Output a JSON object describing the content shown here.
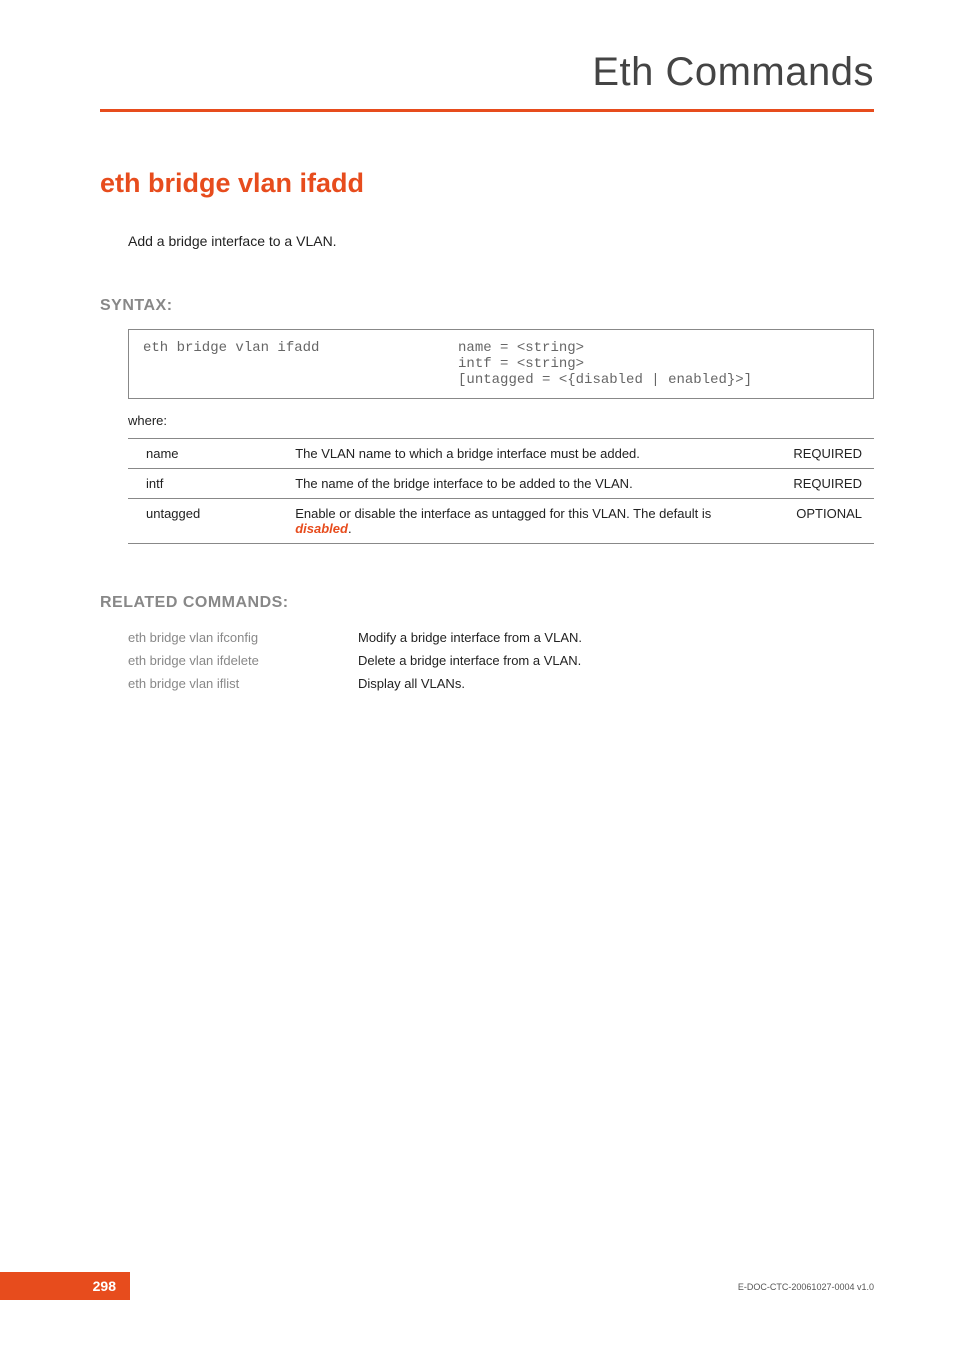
{
  "header": {
    "title": "Eth Commands"
  },
  "command": {
    "title": "eth bridge vlan ifadd",
    "description": "Add a bridge interface to a VLAN."
  },
  "syntax": {
    "label": "SYNTAX:",
    "left": "eth bridge vlan ifadd",
    "right": "name = <string>\nintf = <string>\n[untagged = <{disabled | enabled}>]",
    "where": "where:"
  },
  "params": [
    {
      "name": "name",
      "desc": "The VLAN name to which a bridge interface must be added.",
      "req": "REQUIRED"
    },
    {
      "name": "intf",
      "desc": "The name of the bridge interface to be added to the VLAN.",
      "req": "REQUIRED"
    },
    {
      "name": "untagged",
      "desc_pre": "Enable or disable the interface as untagged for this VLAN. The default is ",
      "desc_em": "disabled",
      "desc_post": ".",
      "req": "OPTIONAL"
    }
  ],
  "related": {
    "label": "RELATED COMMANDS:",
    "items": [
      {
        "cmd": "eth bridge vlan ifconfig",
        "desc": "Modify a bridge interface from a VLAN."
      },
      {
        "cmd": "eth bridge vlan ifdelete",
        "desc": "Delete a bridge interface from a VLAN."
      },
      {
        "cmd": "eth bridge vlan iflist",
        "desc": "Display all VLANs."
      }
    ]
  },
  "footer": {
    "page": "298",
    "doc": "E-DOC-CTC-20061027-0004 v1.0"
  }
}
